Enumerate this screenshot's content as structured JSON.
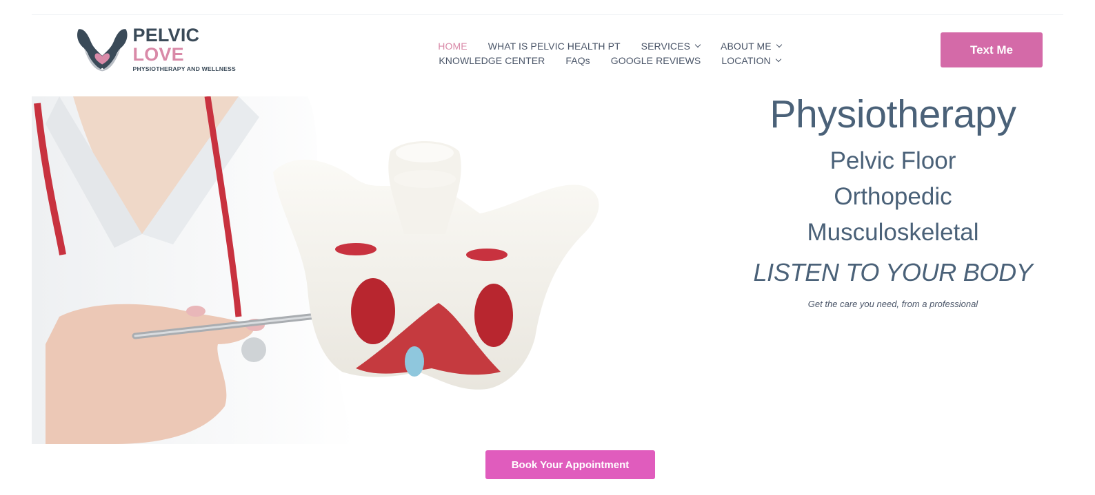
{
  "logo": {
    "word_main": "PELVIC",
    "word_accent": "LOVE",
    "tagline": "PHYSIOTHERAPY AND WELLNESS"
  },
  "nav": {
    "row1": [
      {
        "label": "HOME",
        "active": true,
        "dropdown": false
      },
      {
        "label": "WHAT IS PELVIC HEALTH PT",
        "active": false,
        "dropdown": false
      },
      {
        "label": "SERVICES",
        "active": false,
        "dropdown": true
      },
      {
        "label": "ABOUT ME",
        "active": false,
        "dropdown": true
      }
    ],
    "row2": [
      {
        "label": "KNOWLEDGE CENTER",
        "active": false,
        "dropdown": false
      },
      {
        "label": "FAQs",
        "active": false,
        "dropdown": false
      },
      {
        "label": "GOOGLE REVIEWS",
        "active": false,
        "dropdown": false
      },
      {
        "label": "LOCATION",
        "active": false,
        "dropdown": true
      }
    ]
  },
  "header": {
    "cta_label": "Text Me"
  },
  "hero": {
    "title": "Physiotherapy",
    "lines": [
      "Pelvic Floor",
      "Orthopedic",
      "Musculoskeletal"
    ],
    "tagline": "LISTEN TO YOUR BODY",
    "subtext": "Get the care you need, from a professional",
    "book_label": "Book Your Appointment"
  },
  "colors": {
    "brand_pink": "#d46aa8",
    "book_pink": "#e05cbd",
    "nav_active": "#d98aa8",
    "heading_blue": "#4a6178",
    "logo_dark": "#3a4a58"
  }
}
